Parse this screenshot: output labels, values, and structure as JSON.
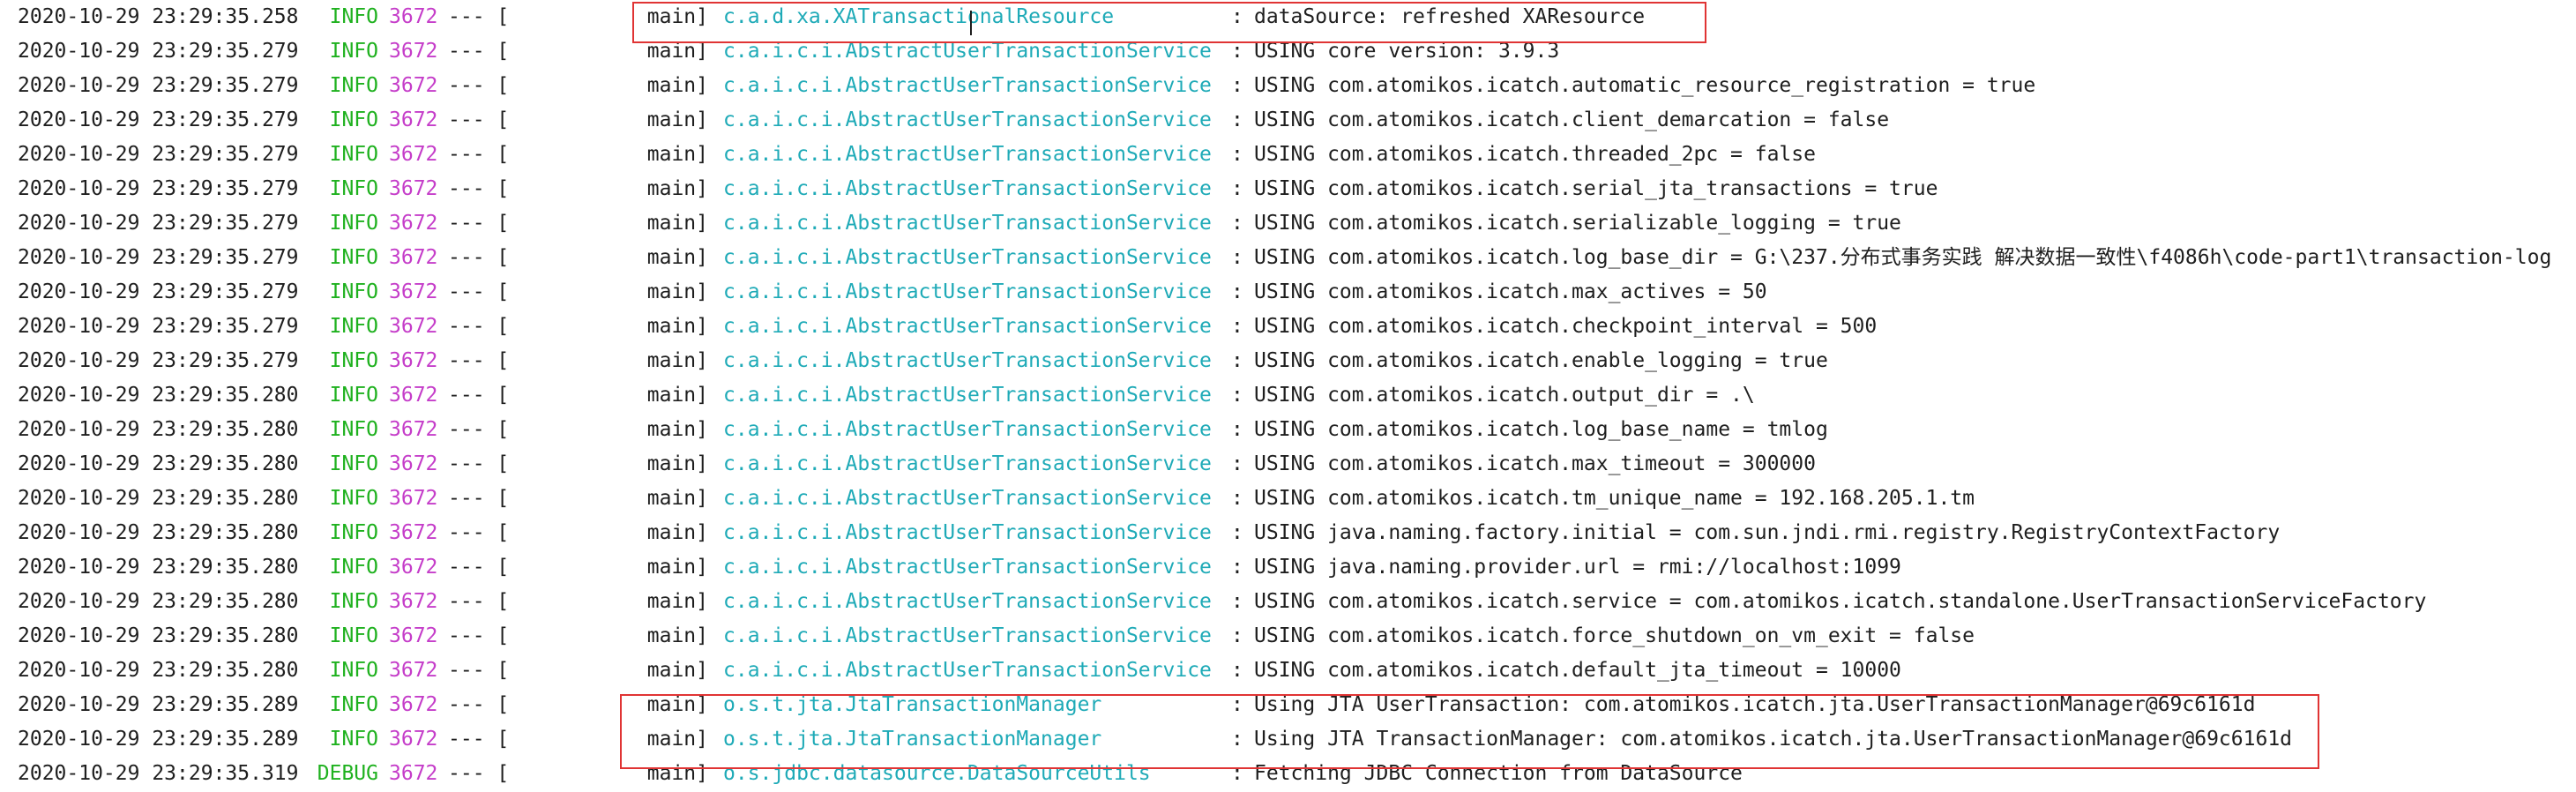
{
  "colors": {
    "info": "#1fb11f",
    "pid": "#c53dc9",
    "logger": "#1eaab7",
    "highlight_box": "#e03434"
  },
  "lines": [
    {
      "ts": "2020-10-29 23:29:35.258",
      "level": "INFO",
      "pid": "3672",
      "sep": "--- [",
      "thread": "main]",
      "logger": "c.a.d.xa.XATransactionalResource",
      "colon": ":",
      "msg": "dataSource: refreshed XAResource"
    },
    {
      "ts": "2020-10-29 23:29:35.279",
      "level": "INFO",
      "pid": "3672",
      "sep": "--- [",
      "thread": "main]",
      "logger": "c.a.i.c.i.AbstractUserTransactionService",
      "colon": ":",
      "msg": "USING core version: 3.9.3"
    },
    {
      "ts": "2020-10-29 23:29:35.279",
      "level": "INFO",
      "pid": "3672",
      "sep": "--- [",
      "thread": "main]",
      "logger": "c.a.i.c.i.AbstractUserTransactionService",
      "colon": ":",
      "msg": "USING com.atomikos.icatch.automatic_resource_registration = true"
    },
    {
      "ts": "2020-10-29 23:29:35.279",
      "level": "INFO",
      "pid": "3672",
      "sep": "--- [",
      "thread": "main]",
      "logger": "c.a.i.c.i.AbstractUserTransactionService",
      "colon": ":",
      "msg": "USING com.atomikos.icatch.client_demarcation = false"
    },
    {
      "ts": "2020-10-29 23:29:35.279",
      "level": "INFO",
      "pid": "3672",
      "sep": "--- [",
      "thread": "main]",
      "logger": "c.a.i.c.i.AbstractUserTransactionService",
      "colon": ":",
      "msg": "USING com.atomikos.icatch.threaded_2pc = false"
    },
    {
      "ts": "2020-10-29 23:29:35.279",
      "level": "INFO",
      "pid": "3672",
      "sep": "--- [",
      "thread": "main]",
      "logger": "c.a.i.c.i.AbstractUserTransactionService",
      "colon": ":",
      "msg": "USING com.atomikos.icatch.serial_jta_transactions = true"
    },
    {
      "ts": "2020-10-29 23:29:35.279",
      "level": "INFO",
      "pid": "3672",
      "sep": "--- [",
      "thread": "main]",
      "logger": "c.a.i.c.i.AbstractUserTransactionService",
      "colon": ":",
      "msg": "USING com.atomikos.icatch.serializable_logging = true"
    },
    {
      "ts": "2020-10-29 23:29:35.279",
      "level": "INFO",
      "pid": "3672",
      "sep": "--- [",
      "thread": "main]",
      "logger": "c.a.i.c.i.AbstractUserTransactionService",
      "colon": ":",
      "msg": "USING com.atomikos.icatch.log_base_dir = G:\\237.分布式事务实践 解决数据一致性\\f4086h\\code-part1\\transaction-log"
    },
    {
      "ts": "2020-10-29 23:29:35.279",
      "level": "INFO",
      "pid": "3672",
      "sep": "--- [",
      "thread": "main]",
      "logger": "c.a.i.c.i.AbstractUserTransactionService",
      "colon": ":",
      "msg": "USING com.atomikos.icatch.max_actives = 50"
    },
    {
      "ts": "2020-10-29 23:29:35.279",
      "level": "INFO",
      "pid": "3672",
      "sep": "--- [",
      "thread": "main]",
      "logger": "c.a.i.c.i.AbstractUserTransactionService",
      "colon": ":",
      "msg": "USING com.atomikos.icatch.checkpoint_interval = 500"
    },
    {
      "ts": "2020-10-29 23:29:35.279",
      "level": "INFO",
      "pid": "3672",
      "sep": "--- [",
      "thread": "main]",
      "logger": "c.a.i.c.i.AbstractUserTransactionService",
      "colon": ":",
      "msg": "USING com.atomikos.icatch.enable_logging = true"
    },
    {
      "ts": "2020-10-29 23:29:35.280",
      "level": "INFO",
      "pid": "3672",
      "sep": "--- [",
      "thread": "main]",
      "logger": "c.a.i.c.i.AbstractUserTransactionService",
      "colon": ":",
      "msg": "USING com.atomikos.icatch.output_dir = .\\"
    },
    {
      "ts": "2020-10-29 23:29:35.280",
      "level": "INFO",
      "pid": "3672",
      "sep": "--- [",
      "thread": "main]",
      "logger": "c.a.i.c.i.AbstractUserTransactionService",
      "colon": ":",
      "msg": "USING com.atomikos.icatch.log_base_name = tmlog"
    },
    {
      "ts": "2020-10-29 23:29:35.280",
      "level": "INFO",
      "pid": "3672",
      "sep": "--- [",
      "thread": "main]",
      "logger": "c.a.i.c.i.AbstractUserTransactionService",
      "colon": ":",
      "msg": "USING com.atomikos.icatch.max_timeout = 300000"
    },
    {
      "ts": "2020-10-29 23:29:35.280",
      "level": "INFO",
      "pid": "3672",
      "sep": "--- [",
      "thread": "main]",
      "logger": "c.a.i.c.i.AbstractUserTransactionService",
      "colon": ":",
      "msg": "USING com.atomikos.icatch.tm_unique_name = 192.168.205.1.tm"
    },
    {
      "ts": "2020-10-29 23:29:35.280",
      "level": "INFO",
      "pid": "3672",
      "sep": "--- [",
      "thread": "main]",
      "logger": "c.a.i.c.i.AbstractUserTransactionService",
      "colon": ":",
      "msg": "USING java.naming.factory.initial = com.sun.jndi.rmi.registry.RegistryContextFactory"
    },
    {
      "ts": "2020-10-29 23:29:35.280",
      "level": "INFO",
      "pid": "3672",
      "sep": "--- [",
      "thread": "main]",
      "logger": "c.a.i.c.i.AbstractUserTransactionService",
      "colon": ":",
      "msg": "USING java.naming.provider.url = rmi://localhost:1099"
    },
    {
      "ts": "2020-10-29 23:29:35.280",
      "level": "INFO",
      "pid": "3672",
      "sep": "--- [",
      "thread": "main]",
      "logger": "c.a.i.c.i.AbstractUserTransactionService",
      "colon": ":",
      "msg": "USING com.atomikos.icatch.service = com.atomikos.icatch.standalone.UserTransactionServiceFactory"
    },
    {
      "ts": "2020-10-29 23:29:35.280",
      "level": "INFO",
      "pid": "3672",
      "sep": "--- [",
      "thread": "main]",
      "logger": "c.a.i.c.i.AbstractUserTransactionService",
      "colon": ":",
      "msg": "USING com.atomikos.icatch.force_shutdown_on_vm_exit = false"
    },
    {
      "ts": "2020-10-29 23:29:35.280",
      "level": "INFO",
      "pid": "3672",
      "sep": "--- [",
      "thread": "main]",
      "logger": "c.a.i.c.i.AbstractUserTransactionService",
      "colon": ":",
      "msg": "USING com.atomikos.icatch.default_jta_timeout = 10000"
    },
    {
      "ts": "2020-10-29 23:29:35.289",
      "level": "INFO",
      "pid": "3672",
      "sep": "--- [",
      "thread": "main]",
      "logger": "o.s.t.jta.JtaTransactionManager",
      "colon": ":",
      "msg": "Using JTA UserTransaction: com.atomikos.icatch.jta.UserTransactionManager@69c6161d"
    },
    {
      "ts": "2020-10-29 23:29:35.289",
      "level": "INFO",
      "pid": "3672",
      "sep": "--- [",
      "thread": "main]",
      "logger": "o.s.t.jta.JtaTransactionManager",
      "colon": ":",
      "msg": "Using JTA TransactionManager: com.atomikos.icatch.jta.UserTransactionManager@69c6161d"
    },
    {
      "ts": "2020-10-29 23:29:35.319",
      "level": "DEBUG",
      "pid": "3672",
      "sep": "--- [",
      "thread": "main]",
      "logger": "o.s.jdbc.datasource.DataSourceUtils",
      "colon": ":",
      "msg": "Fetching JDBC Connection from DataSource"
    }
  ]
}
